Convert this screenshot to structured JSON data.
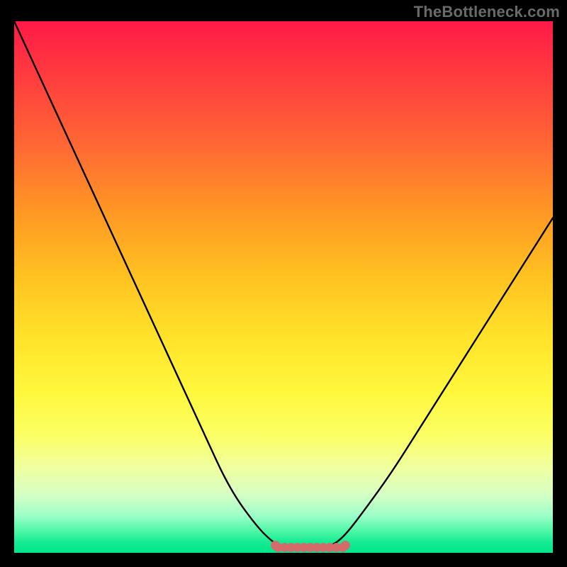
{
  "attribution": "TheBottleneck.com",
  "colors": {
    "background": "#000000",
    "curve_stroke": "#000000",
    "marker_fill": "#d46a6a",
    "marker_stroke": "#c25555",
    "gradient_top": "#ff1a47",
    "gradient_bottom": "#00e58c",
    "attribution": "#6a6a6a"
  },
  "chart_data": {
    "type": "line",
    "title": "",
    "xlabel": "",
    "ylabel": "",
    "xlim": [
      0,
      100
    ],
    "ylim": [
      0,
      100
    ],
    "x": [
      0,
      5,
      10,
      15,
      20,
      25,
      30,
      35,
      40,
      45,
      48,
      50,
      52,
      55,
      58,
      60,
      62,
      65,
      70,
      75,
      80,
      85,
      90,
      95,
      100
    ],
    "values": [
      100,
      89,
      78,
      67,
      56,
      45,
      34,
      23,
      12,
      5,
      2,
      1,
      1,
      1,
      1,
      2,
      4,
      8,
      15,
      23,
      31,
      39,
      47,
      55,
      63
    ],
    "highlight_region": {
      "x_start": 49,
      "x_end": 61,
      "value": 1
    },
    "grid": false,
    "legend": false
  }
}
